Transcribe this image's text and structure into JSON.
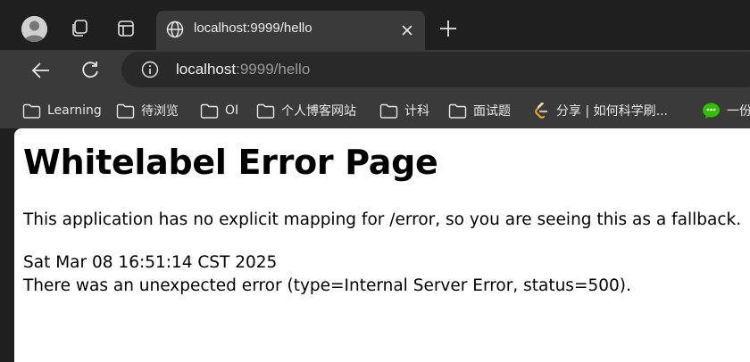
{
  "browser": {
    "tab": {
      "title": "localhost:9999/hello"
    },
    "address_bar": {
      "host": "localhost",
      "rest": ":9999/hello"
    },
    "bookmarks": [
      {
        "label": "Learning",
        "type": "folder"
      },
      {
        "label": "待浏览",
        "type": "folder"
      },
      {
        "label": "OI",
        "type": "folder"
      },
      {
        "label": "个人博客网站",
        "type": "folder"
      },
      {
        "label": "计科",
        "type": "folder"
      },
      {
        "label": "面试题",
        "type": "folder"
      },
      {
        "label": "分享 | 如何科学刷...",
        "type": "link",
        "icon": "leetcode-icon"
      },
      {
        "label": "一份",
        "type": "link",
        "icon": "wechat-icon"
      }
    ]
  },
  "page": {
    "heading": "Whitelabel Error Page",
    "message": "This application has no explicit mapping for /error, so you are seeing this as a fallback.",
    "timestamp": "Sat Mar 08 16:51:14 CST 2025",
    "error": "There was an unexpected error (type=Internal Server Error, status=500)."
  },
  "colors": {
    "chrome_dark": "#1f1f1f",
    "chrome_toolbar": "#3a3a3a",
    "omnibox": "#292929",
    "page_bg": "#ffffff"
  }
}
